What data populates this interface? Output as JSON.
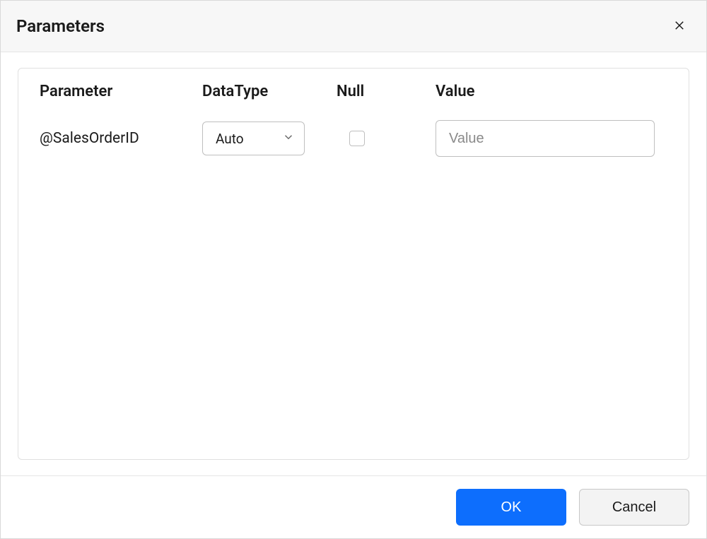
{
  "dialog": {
    "title": "Parameters"
  },
  "columns": {
    "parameter": "Parameter",
    "datatype": "DataType",
    "null": "Null",
    "value": "Value"
  },
  "rows": [
    {
      "name": "@SalesOrderID",
      "datatype": "Auto",
      "null_checked": false,
      "value": "",
      "value_placeholder": "Value"
    }
  ],
  "footer": {
    "ok": "OK",
    "cancel": "Cancel"
  }
}
